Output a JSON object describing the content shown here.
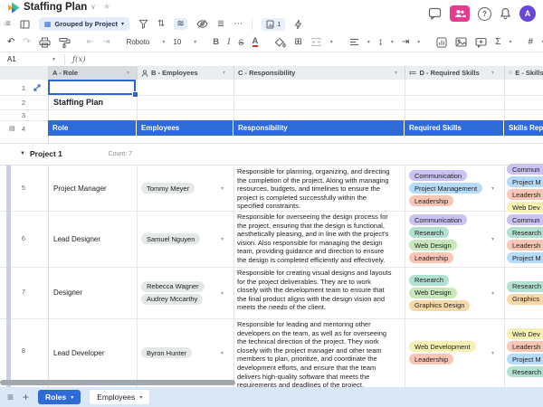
{
  "chip_colors": {
    "lavender": "#c9c3f1",
    "blue": "#b5dbf8",
    "salmon": "#f9c6b5",
    "teal": "#b0e1d1",
    "green": "#c8e7bb",
    "orange": "#f8d8a8",
    "yellow": "#f6f0b2",
    "gray": "#e5e9e6"
  },
  "titlebar": {
    "title": "Staffing Plan"
  },
  "top_actions": {
    "avatar_initial": "A",
    "help_label": "?"
  },
  "toolbar": {
    "grouped_by": "Grouped by Project",
    "records_count": "1",
    "font": "Roboto",
    "font_size": "10",
    "bold": "B",
    "italic": "I",
    "strike": "S",
    "text_color": "A",
    "sum": "Σ",
    "hash": "#",
    "more": "⋯"
  },
  "formula_bar": {
    "cell_ref": "A1",
    "fx": "ƒ(x)"
  },
  "column_headers": [
    {
      "label": "A - Role"
    },
    {
      "label": "B - Employees"
    },
    {
      "label": "C - Responsibility"
    },
    {
      "label": "D - Required Skills"
    },
    {
      "label": "E - Skills"
    }
  ],
  "sheet": {
    "doc_title_cell": "Staffing Plan",
    "table_header": [
      "Role",
      "Employees",
      "Responsibility",
      "Required Skills",
      "Skills Repr"
    ],
    "group": {
      "name": "Project 1",
      "count": "Count: 7"
    },
    "row_numbers": [
      "1",
      "2",
      "3",
      "4",
      "5",
      "6",
      "7",
      "8"
    ],
    "rows": [
      {
        "num": "5",
        "role": "Project Manager",
        "employees": [
          {
            "label": "Tommy Meyer",
            "color": "gray"
          }
        ],
        "responsibility": "Responsible for planning, organizing, and directing the completion of the project. Along with managing resources, budgets, and timelines to ensure the project is completed successfully within the specified constraints.",
        "skills": [
          {
            "label": "Communication",
            "color": "lavender"
          },
          {
            "label": "Project Management",
            "color": "blue"
          },
          {
            "label": "Leadership",
            "color": "salmon"
          }
        ],
        "skills_rep": [
          {
            "label": "Commun",
            "color": "lavender"
          },
          {
            "label": "Project M",
            "color": "blue"
          },
          {
            "label": "Leadersh",
            "color": "salmon"
          },
          {
            "label": "Web Dev",
            "color": "yellow"
          }
        ]
      },
      {
        "num": "6",
        "role": "Lead Designer",
        "employees": [
          {
            "label": "Samuel Nguyen",
            "color": "gray"
          }
        ],
        "responsibility": "Responsible for overseeing the design process for the project, ensuring that the design is functional, aesthetically pleasing, and in line with the project's vision. Also responsible for managing the design team, providing guidance and direction to ensure the design is completed efficiently and effectively.",
        "skills": [
          {
            "label": "Communication",
            "color": "lavender"
          },
          {
            "label": "Research",
            "color": "teal"
          },
          {
            "label": "Web Design",
            "color": "green"
          },
          {
            "label": "Leadership",
            "color": "salmon"
          }
        ],
        "skills_rep": [
          {
            "label": "Commun",
            "color": "lavender"
          },
          {
            "label": "Research",
            "color": "teal"
          },
          {
            "label": "Leadersh",
            "color": "salmon"
          },
          {
            "label": "Project M",
            "color": "blue"
          }
        ]
      },
      {
        "num": "7",
        "role": "Designer",
        "employees": [
          {
            "label": "Rebecca Wagner",
            "color": "gray"
          },
          {
            "label": "Audrey Mccarthy",
            "color": "gray"
          }
        ],
        "responsibility": "Responsible for creating visual designs and layouts for the project deliverables. They are to work closely with the development team to ensure that the final product aligns with the design vision and meets the needs of the client.",
        "skills": [
          {
            "label": "Research",
            "color": "teal"
          },
          {
            "label": "Web Design",
            "color": "green"
          },
          {
            "label": "Graphics Design",
            "color": "orange"
          }
        ],
        "skills_rep": [
          {
            "label": "Research",
            "color": "teal"
          },
          {
            "label": "Graphics",
            "color": "orange"
          }
        ]
      },
      {
        "num": "8",
        "role": "Lead Developer",
        "employees": [
          {
            "label": "Byron Hunter",
            "color": "gray"
          }
        ],
        "responsibility": "Responsible for leading and mentoring other developers on the team, as well as for overseeing the technical direction of the project. They work closely with the project manager and other team members to plan, prioritize, and coordinate the development efforts, and ensure that the team delivers high-quality software that meets the requirements and deadlines of the project.",
        "skills": [
          {
            "label": "Web Development",
            "color": "yellow"
          },
          {
            "label": "Leadership",
            "color": "salmon"
          }
        ],
        "skills_rep": [
          {
            "label": "Web Dev",
            "color": "yellow"
          },
          {
            "label": "Leadersh",
            "color": "salmon"
          },
          {
            "label": "Project M",
            "color": "blue"
          },
          {
            "label": "Research",
            "color": "teal"
          }
        ]
      }
    ]
  },
  "tabbar": {
    "tabs": [
      {
        "label": "Roles",
        "active": true
      },
      {
        "label": "Employees",
        "active": false
      }
    ]
  }
}
